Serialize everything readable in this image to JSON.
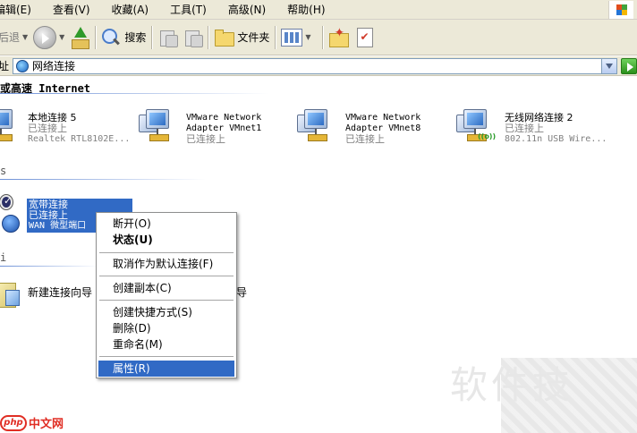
{
  "menubar": {
    "items": [
      "编辑(E)",
      "查看(V)",
      "收藏(A)",
      "工具(T)",
      "高级(N)",
      "帮助(H)"
    ]
  },
  "toolbar": {
    "back_label": "后退",
    "search_label": "搜索",
    "folders_label": "文件夹"
  },
  "address": {
    "label": "址",
    "value": "网络连接"
  },
  "groups": {
    "lan": "或高速 Internet",
    "broadband": "s",
    "wizard": "i"
  },
  "connections": [
    {
      "name": "本地连接 5",
      "status": "已连接上",
      "device": "Realtek RTL8102E..."
    },
    {
      "name": "VMware Network",
      "name2": "Adapter VMnet1",
      "status": "已连接上"
    },
    {
      "name": "VMware Network",
      "name2": "Adapter VMnet8",
      "status": "已连接上"
    },
    {
      "name": "无线网络连接 2",
      "status": "已连接上",
      "device": "802.11n USB Wire..."
    }
  ],
  "broadband_conn": {
    "name": "宽带连接",
    "status": "已连接上",
    "device": "WAN 微型端口"
  },
  "wizards": {
    "new_conn": "新建连接向导",
    "partial": "导"
  },
  "context_menu": {
    "disconnect": "断开(O)",
    "status": "状态(U)",
    "cancel_default": "取消作为默认连接(F)",
    "copy": "创建副本(C)",
    "shortcut": "创建快捷方式(S)",
    "delete": "删除(D)",
    "rename": "重命名(M)",
    "properties": "属性(R)"
  },
  "watermark": "软件技",
  "logo": {
    "badge": "php",
    "text": "中文网"
  }
}
